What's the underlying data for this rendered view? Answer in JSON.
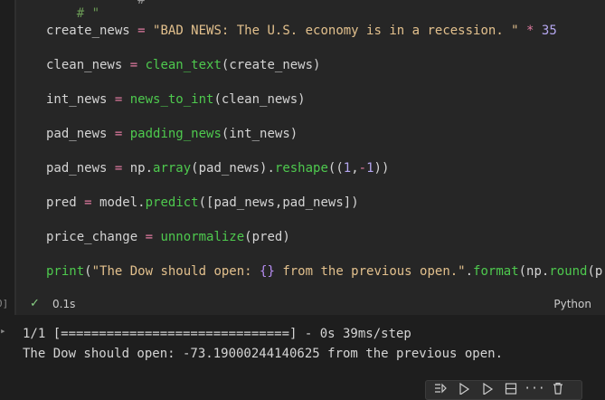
{
  "cell": {
    "execution_count": "0]",
    "status": {
      "time": "0.1s",
      "language": "Python"
    },
    "lines": [
      "    # \"",
      "create_news = \"BAD NEWS: The U.S. economy is in a recession. \" * 35",
      "clean_news = clean_text(create_news)",
      "int_news = news_to_int(clean_news)",
      "pad_news = padding_news(int_news)",
      "pad_news = np.array(pad_news).reshape((1,-1))",
      "pred = model.predict([pad_news,pad_news])",
      "price_change = unnormalize(pred)",
      "print(\"The Dow should open: {} from the previous open.\".format(np.round(p"
    ]
  },
  "output": {
    "lines": [
      "1/1 [==============================] - 0s 39ms/step",
      "The Dow should open: -73.19000244140625 from the previous open."
    ]
  },
  "toolbar": {
    "icons": [
      "run-by-line-icon",
      "run-above-icon",
      "run-below-icon",
      "split-cell-icon",
      "more-icon",
      "delete-icon"
    ],
    "more_label": "···"
  },
  "colors": {
    "background": "#1e1e1e",
    "cell_background": "#262626",
    "function": "#4ec94e",
    "string": "#e2c08d",
    "number": "#b5a7f0",
    "operator": "#e07aa0",
    "success": "#89d185"
  }
}
